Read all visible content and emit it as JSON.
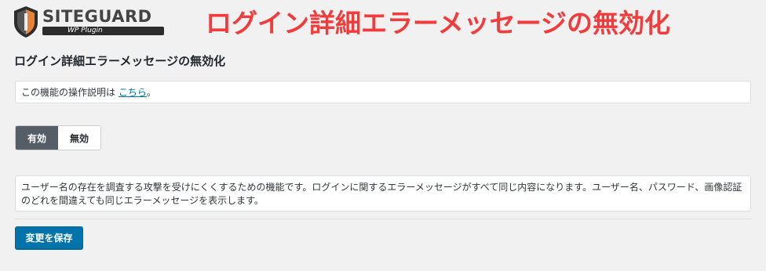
{
  "logo": {
    "brand": "SITEGUARD",
    "subtitle": "WP Plugin"
  },
  "headline": "ログイン詳細エラーメッセージの無効化",
  "page_title": "ログイン詳細エラーメッセージの無効化",
  "help": {
    "prefix": "この機能の操作説明は ",
    "link_label": "こちら",
    "suffix": "。"
  },
  "toggle": {
    "enabled_label": "有効",
    "disabled_label": "無効",
    "selected": "有効"
  },
  "description": "ユーザー名の存在を調査する攻撃を受けにくくするための機能です。ログインに関するエラーメッセージがすべて同じ内容になります。ユーザー名、パスワード、画像認証のどれを間違えても同じエラーメッセージを表示します。",
  "save_label": "変更を保存",
  "colors": {
    "accent": "#0073aa",
    "headline": "#f23b3b",
    "toggle_active": "#555d66",
    "logo_orange": "#e8823a"
  }
}
